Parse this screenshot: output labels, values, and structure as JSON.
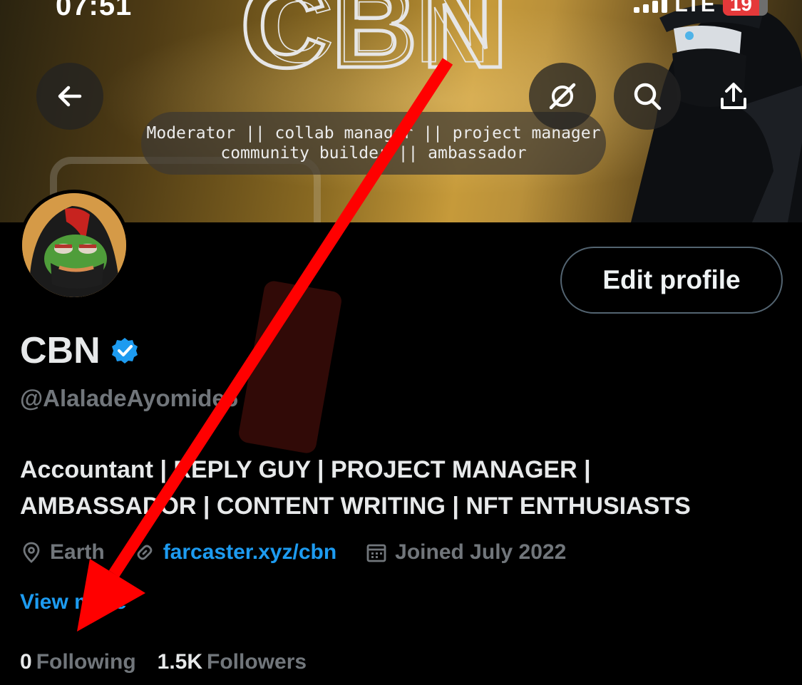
{
  "status_bar": {
    "time": "07:51",
    "network": "LTE",
    "battery": "19"
  },
  "banner": {
    "logo_text": "CBN",
    "tagline_line1": "Moderator || collab manager || project manager",
    "tagline_line2": "community builder || ambassador"
  },
  "header_actions": {
    "back_icon": "arrow-left-icon",
    "grok_icon": "grok-icon",
    "search_icon": "search-icon",
    "share_icon": "share-icon"
  },
  "profile": {
    "display_name": "CBN",
    "verified": true,
    "handle": "@AlaladeAyomide6",
    "edit_profile_label": "Edit profile",
    "bio_line1": "Accountant | REPLY GUY | PROJECT MANAGER |",
    "bio_line2": "AMBASSADOR | CONTENT WRITING | NFT ENTHUSIASTS",
    "location": "Earth",
    "website": "farcaster.xyz/cbn",
    "joined": "Joined July 2022",
    "view_more": "View more",
    "following_count": "0",
    "following_label": "Following",
    "followers_count": "1.5K",
    "followers_label": "Followers"
  },
  "colors": {
    "background": "#000000",
    "accent_blue": "#1d9bf0",
    "secondary_text": "#71767b",
    "annotation_arrow": "#ff0000"
  }
}
